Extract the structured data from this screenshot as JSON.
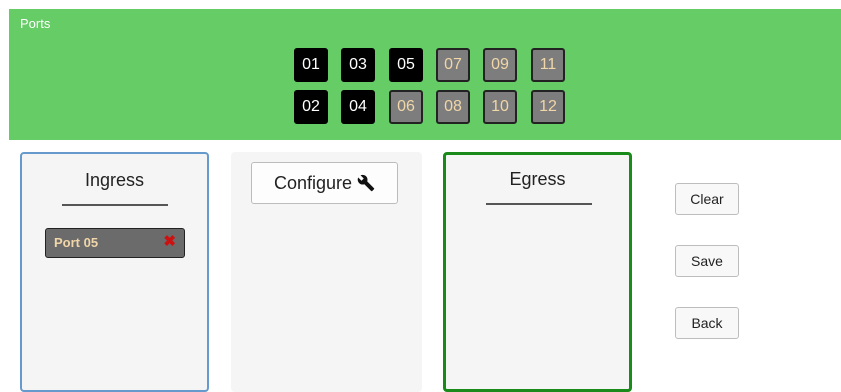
{
  "ports_panel": {
    "title": "Ports",
    "top_row": [
      {
        "label": "01",
        "state": "on"
      },
      {
        "label": "03",
        "state": "on"
      },
      {
        "label": "05",
        "state": "on"
      },
      {
        "label": "07",
        "state": "off"
      },
      {
        "label": "09",
        "state": "off"
      },
      {
        "label": "11",
        "state": "off"
      }
    ],
    "bottom_row": [
      {
        "label": "02",
        "state": "on"
      },
      {
        "label": "04",
        "state": "on"
      },
      {
        "label": "06",
        "state": "off"
      },
      {
        "label": "08",
        "state": "off"
      },
      {
        "label": "10",
        "state": "off"
      },
      {
        "label": "12",
        "state": "off"
      }
    ]
  },
  "ingress": {
    "title": "Ingress",
    "items": [
      {
        "label": "Port 05",
        "remove_glyph": "✖"
      }
    ]
  },
  "configure": {
    "label": "Configure",
    "icon": "wrench-icon"
  },
  "egress": {
    "title": "Egress"
  },
  "actions": {
    "clear": "Clear",
    "save": "Save",
    "back": "Back"
  },
  "colors": {
    "ports_bg": "#66cc66",
    "ingress_border": "#6699cc",
    "egress_border": "#1a8a1a",
    "port_on": "#000000",
    "port_off": "#7d7d7d",
    "remove": "#cc1111"
  }
}
